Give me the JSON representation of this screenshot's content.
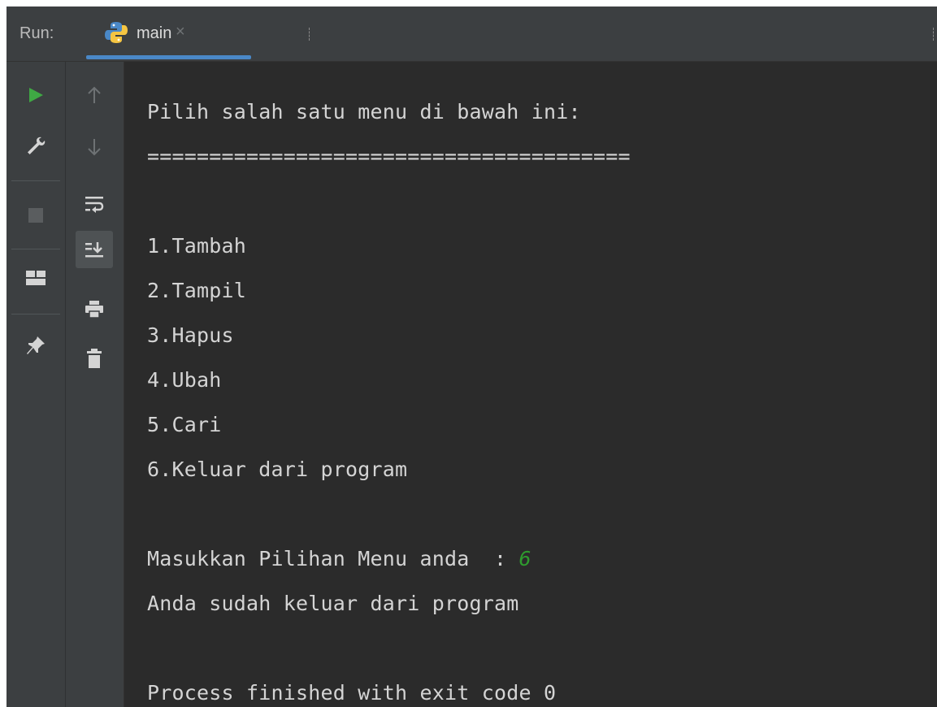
{
  "header": {
    "run_label": "Run:",
    "tab_label": "main",
    "tab_close": "×"
  },
  "toolbar": {
    "icons": [
      "rerun-icon",
      "wrench-icon",
      "stop-icon",
      "layout-icon",
      "pin-icon",
      "arrow-up-icon",
      "arrow-down-icon",
      "soft-wrap-icon",
      "scroll-to-end-icon",
      "print-icon",
      "trash-icon"
    ]
  },
  "console": {
    "lines": [
      "Pilih salah satu menu di bawah ini:",
      "=======================================",
      "1.Tambah",
      "2.Tampil",
      "3.Hapus",
      "4.Ubah",
      "5.Cari",
      "6.Keluar dari program",
      "Masukkan Pilihan Menu anda  : ",
      "Anda sudah keluar dari program",
      "Process finished with exit code 0"
    ],
    "user_input": "6"
  },
  "colors": {
    "background": "#2b2b2b",
    "toolbar": "#3c3f41",
    "text": "#d4d4d4",
    "input": "#2e9b2e",
    "run_green": "#3fa944",
    "tab_underline": "#4a88c7"
  }
}
